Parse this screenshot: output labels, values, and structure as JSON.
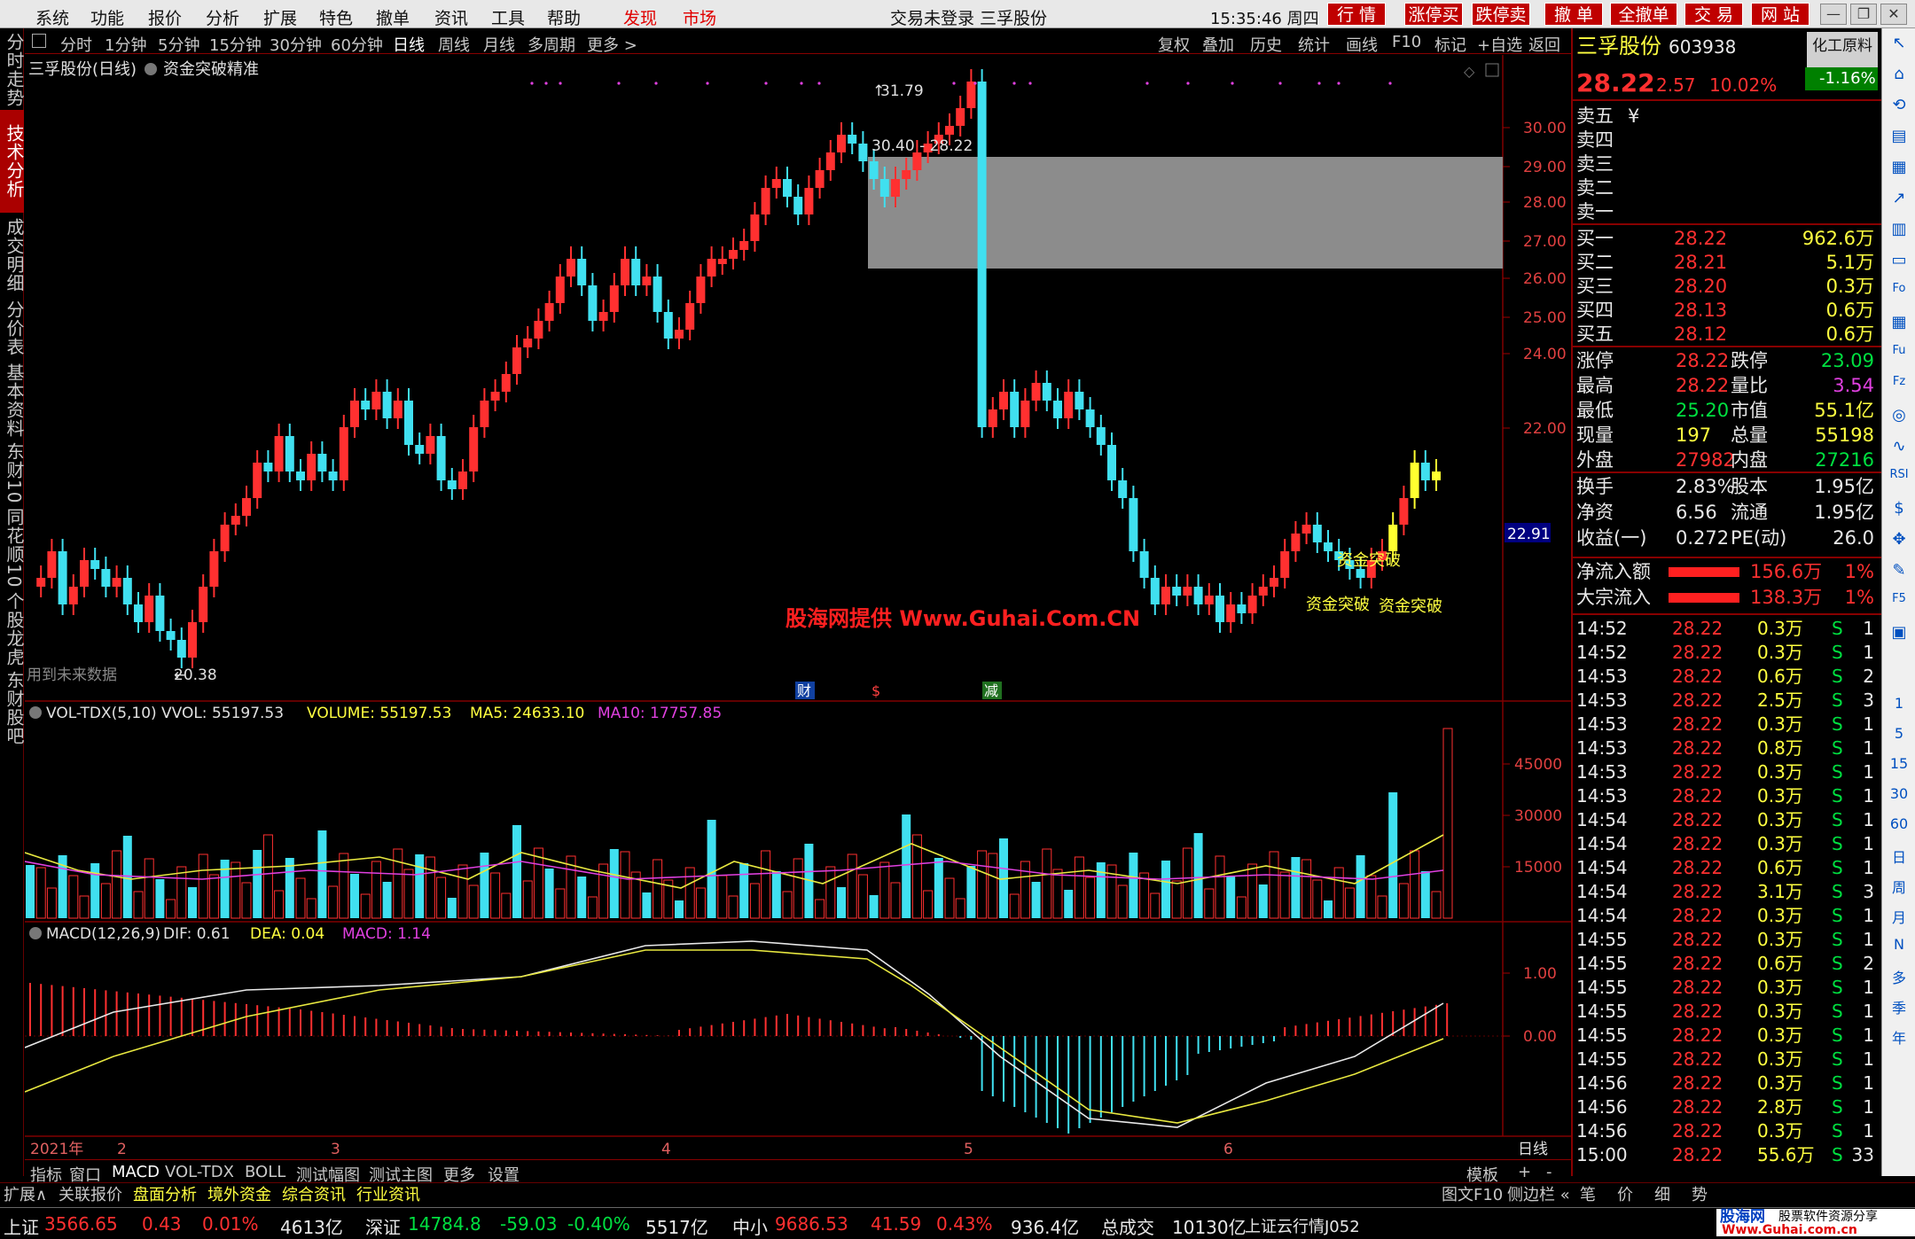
{
  "menu": {
    "items": [
      "系统",
      "功能",
      "报价",
      "分析",
      "扩展",
      "特色",
      "撤单",
      "资讯",
      "工具",
      "帮助"
    ],
    "highlight_items": [
      "发现",
      "市场"
    ],
    "window_title": "交易未登录  三孚股份",
    "clock": "15:35:46 周四",
    "quick_buttons": [
      "行 情",
      "涨停买",
      "跌停卖",
      "撤 单",
      "全撤单",
      "交 易",
      "网 站"
    ]
  },
  "left_tabs": [
    "分时走势",
    "技术分析",
    "成交明细",
    "分价表",
    "基本资料",
    "东财10",
    "同花顺10",
    "个股龙虎",
    "东财股吧"
  ],
  "periods": {
    "items": [
      "分时",
      "1分钟",
      "5分钟",
      "15分钟",
      "30分钟",
      "60分钟",
      "日线",
      "周线",
      "月线",
      "多周期",
      "更多 >"
    ],
    "selected": "日线"
  },
  "toolbar": {
    "items": [
      "复权",
      "叠加",
      "历史",
      "统计",
      "画线",
      "F10",
      "标记",
      "+自选",
      "返回"
    ]
  },
  "main_chart": {
    "title": "三孚股份(日线)",
    "indicator": "资金突破精准",
    "price_axis": [
      "30.00",
      "29.00",
      "28.00",
      "27.00",
      "26.00",
      "25.00",
      "24.00",
      "22.00"
    ],
    "current_price_tag": "22.91",
    "high_label": "31.79",
    "low_label": "20.38",
    "gap_label": "30.40 - 28.22",
    "future_note": "用到未来数据",
    "watermark": "股海网提供 Www.Guhai.Com.CN",
    "signal_labels": [
      "资金突破",
      "资金突破",
      "资金突破"
    ],
    "event_labels": [
      "财",
      "$",
      "减"
    ]
  },
  "volume_panel": {
    "label": "VOL-TDX(5,10)",
    "vvol": "VVOL: 55197.53",
    "volume": "VOLUME: 55197.53",
    "ma5": "MA5: 24633.10",
    "ma10": "MA10: 17757.85",
    "axis": [
      "45000",
      "30000",
      "15000"
    ]
  },
  "macd_panel": {
    "label": "MACD(12,26,9)",
    "dif": "DIF: 0.61",
    "dea": "DEA: 0.04",
    "macd": "MACD: 1.14",
    "axis": [
      "1.00",
      "0.00"
    ]
  },
  "date_axis": [
    "2021年",
    "2",
    "3",
    "4",
    "5",
    "6"
  ],
  "date_axis_right": "日线",
  "bottom_tabs": [
    "指标",
    "窗口",
    "MACD",
    "VOL-TDX",
    "BOLL",
    "测试幅图",
    "测试主图",
    "更多",
    "设置"
  ],
  "bottom_right": [
    "模板",
    "+",
    "-"
  ],
  "ext_bar": {
    "items": [
      "扩展∧",
      "关联报价",
      "盘面分析",
      "境外资金",
      "综合资讯",
      "行业资讯"
    ],
    "right": [
      "图文F10",
      "侧边栏 «",
      "笔",
      "价",
      "细",
      "势"
    ]
  },
  "quote": {
    "name": "三孚股份",
    "code": "603938",
    "industry": "化工原料",
    "price": "28.22",
    "change": "2.57",
    "pct": "10.02%",
    "industry_pct": "-1.16%",
    "sell_levels": [
      "卖五",
      "卖四",
      "卖三",
      "卖二",
      "卖一"
    ],
    "sell_extra": "¥",
    "buy_levels": [
      {
        "label": "买一",
        "price": "28.22",
        "vol": "962.6万"
      },
      {
        "label": "买二",
        "price": "28.21",
        "vol": "5.1万"
      },
      {
        "label": "买三",
        "price": "28.20",
        "vol": "0.3万"
      },
      {
        "label": "买四",
        "price": "28.13",
        "vol": "0.6万"
      },
      {
        "label": "买五",
        "price": "28.12",
        "vol": "0.6万"
      }
    ],
    "stats": [
      {
        "l1": "涨停",
        "v1": "28.22",
        "l2": "跌停",
        "v2": "23.09"
      },
      {
        "l1": "最高",
        "v1": "28.22",
        "l2": "量比",
        "v2": "3.54"
      },
      {
        "l1": "最低",
        "v1": "25.20",
        "l2": "市值",
        "v2": "55.1亿"
      },
      {
        "l1": "现量",
        "v1": "197",
        "l2": "总量",
        "v2": "55198"
      },
      {
        "l1": "外盘",
        "v1": "27982",
        "l2": "内盘",
        "v2": "27216"
      }
    ],
    "stats2": [
      {
        "l1": "换手",
        "v1": "2.83%",
        "l2": "股本",
        "v2": "1.95亿"
      },
      {
        "l1": "净资",
        "v1": "6.56",
        "l2": "流通",
        "v2": "1.95亿"
      },
      {
        "l1": "收益(一)",
        "v1": "0.272",
        "l2": "PE(动)",
        "v2": "26.0"
      }
    ],
    "flows": [
      {
        "label": "净流入额",
        "value": "156.6万",
        "pct": "1%"
      },
      {
        "label": "大宗流入",
        "value": "138.3万",
        "pct": "1%"
      }
    ],
    "ticks": [
      {
        "t": "14:52",
        "p": "28.22",
        "v": "0.3万",
        "s": "S",
        "n": "1"
      },
      {
        "t": "14:52",
        "p": "28.22",
        "v": "0.3万",
        "s": "S",
        "n": "1"
      },
      {
        "t": "14:53",
        "p": "28.22",
        "v": "0.6万",
        "s": "S",
        "n": "2"
      },
      {
        "t": "14:53",
        "p": "28.22",
        "v": "2.5万",
        "s": "S",
        "n": "3"
      },
      {
        "t": "14:53",
        "p": "28.22",
        "v": "0.3万",
        "s": "S",
        "n": "1"
      },
      {
        "t": "14:53",
        "p": "28.22",
        "v": "0.8万",
        "s": "S",
        "n": "1"
      },
      {
        "t": "14:53",
        "p": "28.22",
        "v": "0.3万",
        "s": "S",
        "n": "1"
      },
      {
        "t": "14:53",
        "p": "28.22",
        "v": "0.3万",
        "s": "S",
        "n": "1"
      },
      {
        "t": "14:54",
        "p": "28.22",
        "v": "0.3万",
        "s": "S",
        "n": "1"
      },
      {
        "t": "14:54",
        "p": "28.22",
        "v": "0.3万",
        "s": "S",
        "n": "1"
      },
      {
        "t": "14:54",
        "p": "28.22",
        "v": "0.6万",
        "s": "S",
        "n": "1"
      },
      {
        "t": "14:54",
        "p": "28.22",
        "v": "3.1万",
        "s": "S",
        "n": "3"
      },
      {
        "t": "14:54",
        "p": "28.22",
        "v": "0.3万",
        "s": "S",
        "n": "1"
      },
      {
        "t": "14:55",
        "p": "28.22",
        "v": "0.3万",
        "s": "S",
        "n": "1"
      },
      {
        "t": "14:55",
        "p": "28.22",
        "v": "0.6万",
        "s": "S",
        "n": "2"
      },
      {
        "t": "14:55",
        "p": "28.22",
        "v": "0.3万",
        "s": "S",
        "n": "1"
      },
      {
        "t": "14:55",
        "p": "28.22",
        "v": "0.3万",
        "s": "S",
        "n": "1"
      },
      {
        "t": "14:55",
        "p": "28.22",
        "v": "0.3万",
        "s": "S",
        "n": "1"
      },
      {
        "t": "14:55",
        "p": "28.22",
        "v": "0.3万",
        "s": "S",
        "n": "1"
      },
      {
        "t": "14:56",
        "p": "28.22",
        "v": "0.3万",
        "s": "S",
        "n": "1"
      },
      {
        "t": "14:56",
        "p": "28.22",
        "v": "2.8万",
        "s": "S",
        "n": "1"
      },
      {
        "t": "14:56",
        "p": "28.22",
        "v": "0.3万",
        "s": "S",
        "n": "1"
      },
      {
        "t": "15:00",
        "p": "28.22",
        "v": "55.6万",
        "s": "S",
        "n": "33"
      }
    ]
  },
  "right_tools": [
    "1",
    "5",
    "15",
    "30",
    "60",
    "日",
    "周",
    "月",
    "N",
    "多",
    "季",
    "年"
  ],
  "status": {
    "sh": {
      "name": "上证",
      "val": "3566.65",
      "chg": "0.43",
      "pct": "0.01%",
      "amt": "4613亿"
    },
    "sz": {
      "name": "深证",
      "val": "14784.8",
      "chg": "-59.03",
      "pct": "-0.40%",
      "amt": "5517亿"
    },
    "zx": {
      "name": "中小",
      "val": "9686.53",
      "chg": "41.59",
      "pct": "0.43%",
      "amt": "936.4亿"
    },
    "total": "总成交",
    "total_val": "10130亿",
    "cloud": "上证云行情J052",
    "brand": "股海网",
    "brand2": "股票软件资源分享",
    "brand_url": "Www.Guhai.com.cn"
  },
  "colors": {
    "up": "#ff3030",
    "down": "#40e0f0",
    "ma5": "#e8e8e8",
    "ma10": "#e8e840",
    "ma20": "#e040e0",
    "grid": "#800000"
  }
}
